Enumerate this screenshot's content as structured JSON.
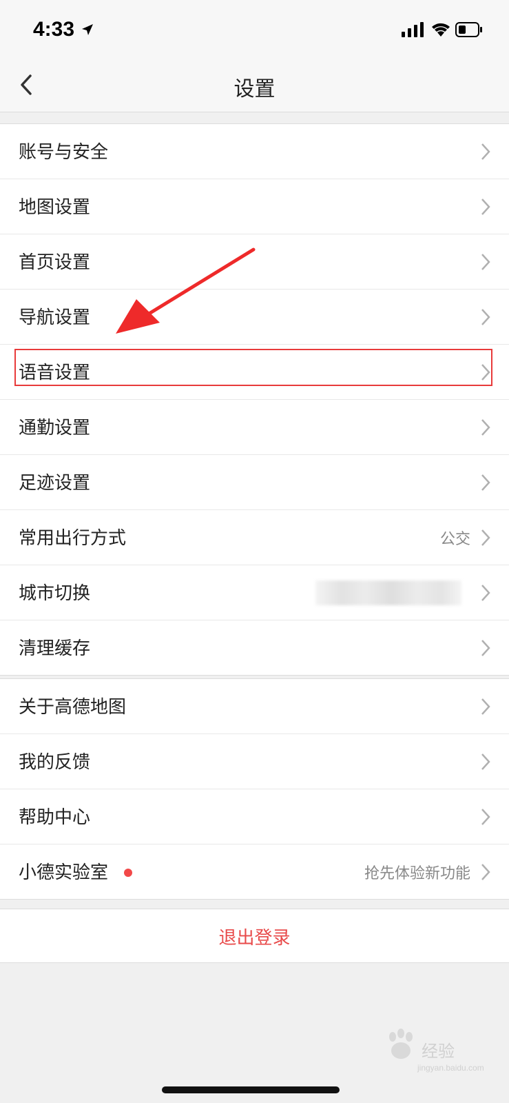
{
  "status_bar": {
    "time": "4:33",
    "icons": [
      "location-arrow-icon",
      "signal-icon",
      "wifi-icon",
      "battery-icon"
    ]
  },
  "nav": {
    "title": "设置",
    "back_icon": "chevron-left-icon"
  },
  "group1": [
    {
      "label": "账号与安全",
      "value": ""
    },
    {
      "label": "地图设置",
      "value": ""
    },
    {
      "label": "首页设置",
      "value": ""
    },
    {
      "label": "导航设置",
      "value": ""
    },
    {
      "label": "语音设置",
      "value": ""
    },
    {
      "label": "通勤设置",
      "value": ""
    },
    {
      "label": "足迹设置",
      "value": ""
    },
    {
      "label": "常用出行方式",
      "value": "公交"
    },
    {
      "label": "城市切换",
      "value": ""
    },
    {
      "label": "清理缓存",
      "value": ""
    }
  ],
  "group2": [
    {
      "label": "关于高德地图",
      "value": ""
    },
    {
      "label": "我的反馈",
      "value": ""
    },
    {
      "label": "帮助中心",
      "value": ""
    },
    {
      "label": "小德实验室",
      "value": "抢先体验新功能"
    }
  ],
  "logout_label": "退出登录",
  "watermark": {
    "text": "经验",
    "sub": "jingyan.baidu.com"
  },
  "colors": {
    "accent_red": "#e84a4a",
    "annotation_red": "#e83a3a",
    "background": "#f0f0f0"
  }
}
